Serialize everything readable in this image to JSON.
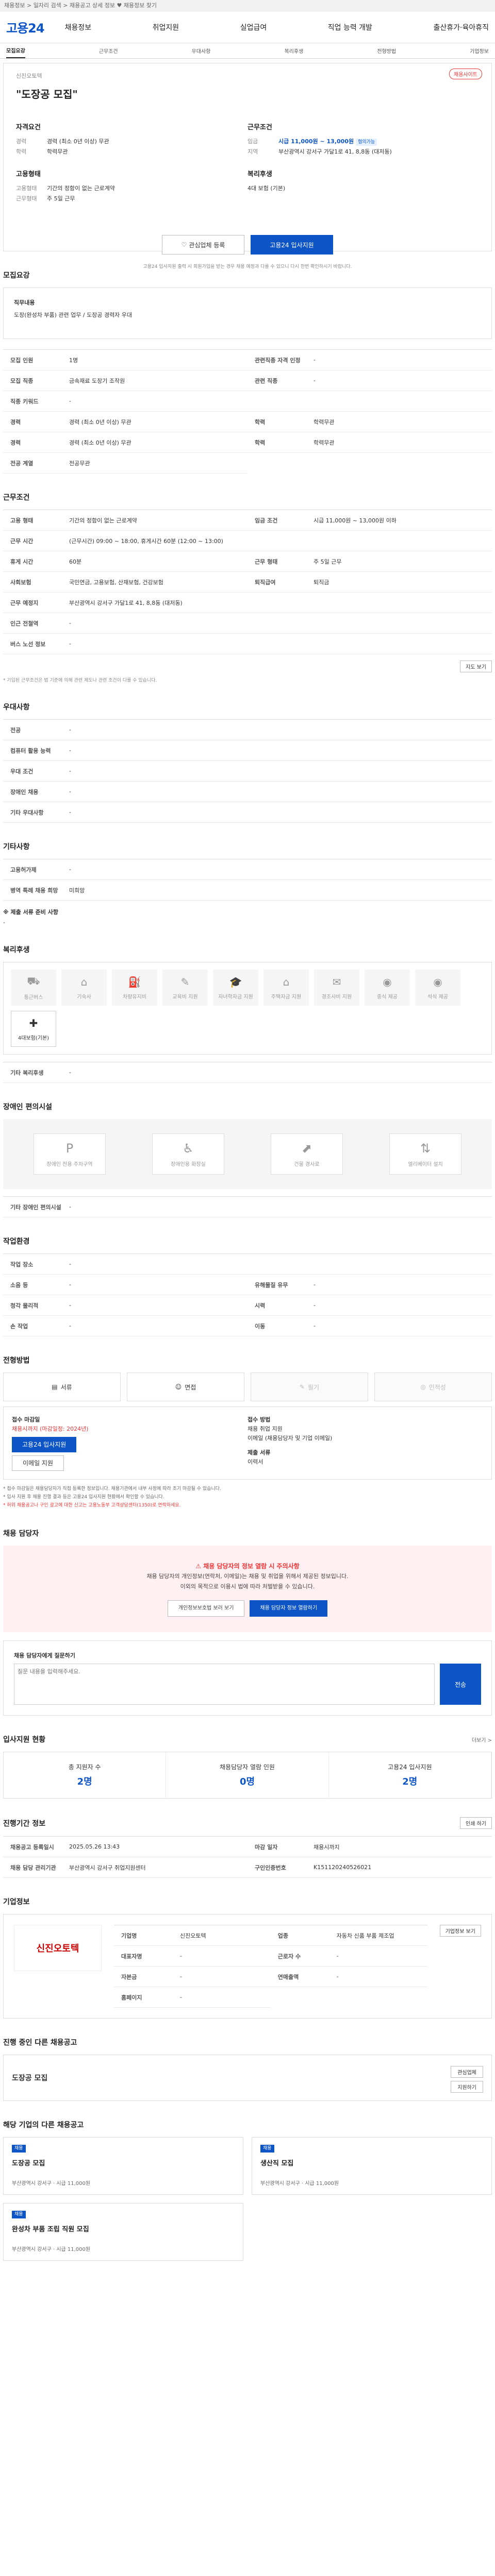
{
  "topbar": {
    "text": "채용정보 > 일자리 검색 > 채용공고 상세 정보 ♥ 채용정보 찾기"
  },
  "header": {
    "logo": "고용24",
    "menu": [
      "채용정보",
      "취업지원",
      "실업급여",
      "직업 능력 개발",
      "출산휴가·육아휴직"
    ]
  },
  "section_tabs": [
    "모집요강",
    "근무조건",
    "우대사항",
    "복리후생",
    "전형방법",
    "기업정보"
  ],
  "summary": {
    "company": "신진오토텍",
    "title": "\"도장공 모집\"",
    "badge": "채용사이트",
    "left_heading": "자격요건",
    "left": [
      {
        "k": "경력",
        "v": "경력 (최소 0년 이상) 무관"
      },
      {
        "k": "학력",
        "v": "학력무관"
      }
    ],
    "left2_heading": "고용형태",
    "left2": [
      {
        "k": "고용형태",
        "v": "기간의 정함이 없는 근로계약"
      },
      {
        "k": "근무형태",
        "v": "주 5일 근무"
      }
    ],
    "right_heading": "근무조건",
    "pay_label": "임금",
    "pay": "시급 11,000원 ~ 13,000원",
    "pay_tag": "협의가능",
    "loc_label": "지역",
    "loc": "부산광역시 강서구 가달1로 41, 8,8동 (대저동)",
    "right2_heading": "복리후생",
    "right2": "4대 보험 (기본)",
    "scrap_btn": "관심업체 등록",
    "apply_btn": "고용24 입사지원",
    "note": "고용24 입사지원 출력 시 회원가입을 받는 경우 채용 예정과 다를 수 있으니 다시 한번 확인하시기 바랍니다."
  },
  "recruit": {
    "heading": "모집요강",
    "duty_label": "직무내용",
    "duty": "도장(완성차 부품) 관련 업무 / 도장공 경력자 우대",
    "rows": [
      {
        "k": "모집 인원",
        "v": "1명"
      },
      {
        "k": "관련직종 자격 인정",
        "v": "-"
      },
      {
        "k": "모집 직종",
        "v": "금속재료 도장기 조작원"
      },
      {
        "k": "관련 직종",
        "v": "-"
      },
      {
        "k": "직종 키워드",
        "v": "-"
      },
      {
        "k": "",
        "v": ""
      },
      {
        "k": "경력",
        "v": "경력 (최소 0년 이상) 무관"
      },
      {
        "k": "학력",
        "v": "학력무관"
      },
      {
        "k": "경력",
        "v": "경력 (최소 0년 이상) 무관"
      },
      {
        "k": "학력",
        "v": "학력무관"
      },
      {
        "k": "전공 계열",
        "v": "전공무관"
      }
    ]
  },
  "work": {
    "heading": "근무조건",
    "rows": [
      {
        "k": "고용 형태",
        "v": "기간의 정함이 없는 근로계약"
      },
      {
        "k": "임금 조건",
        "v": "시급 11,000원 ~ 13,000원 이하"
      },
      {
        "k": "근무 시간",
        "v": "(근무시간) 09:00 ~ 18:00, 휴게시간 60분 (12:00 ~ 13:00)",
        "full": true
      },
      {
        "k": "휴게 시간",
        "v": "60분"
      },
      {
        "k": "근무 형태",
        "v": "주 5일 근무"
      },
      {
        "k": "사회보험",
        "v": "국민연금, 고용보험, 산재보험, 건강보험"
      },
      {
        "k": "퇴직급여",
        "v": "퇴직금"
      },
      {
        "k": "근무 예정지",
        "v": "부산광역시 강서구 가달1로 41, 8,8동 (대저동)",
        "full": true
      },
      {
        "k": "인근 전철역",
        "v": "-",
        "full": true
      },
      {
        "k": "버스 노선 정보",
        "v": "-",
        "full": true
      }
    ],
    "map_btn": "지도 보기",
    "note": "* 기입된 근무조건은 법 기준에 의해 관련 제도나 관련 조건이 다를 수 있습니다."
  },
  "pref": {
    "heading": "우대사항",
    "rows": [
      {
        "k": "전공",
        "v": "-"
      },
      {
        "k": "컴퓨터 활용 능력",
        "v": "-"
      },
      {
        "k": "우대 조건",
        "v": "-"
      },
      {
        "k": "장애인 채용",
        "v": "-"
      },
      {
        "k": "기타 우대사항",
        "v": "-"
      }
    ]
  },
  "etc": {
    "heading": "기타사항",
    "rows": [
      {
        "k": "고용허가제",
        "v": "-"
      },
      {
        "k": "병역 특례 채용 희망",
        "v": "미희망"
      }
    ],
    "docs_label": "※ 제출 서류 준비 사항",
    "docs": "-"
  },
  "welfare": {
    "heading": "복리후생",
    "items": [
      "통근버스",
      "기숙사",
      "차량유지비",
      "교육비 지원",
      "자녀학자금 지원",
      "주택자금 지원",
      "경조사비 지원",
      "중식 제공",
      "석식 제공",
      "4대보험(기본)"
    ],
    "etc_label": "기타 복리후생",
    "etc": "-"
  },
  "disability": {
    "heading": "장애인 편의시설",
    "items": [
      "장애인 전용 주차구역",
      "장애인용 화장실",
      "건물 경사로",
      "엘리베이터 설치"
    ],
    "etc_label": "기타 장애인 편의시설",
    "etc": "-"
  },
  "place": {
    "heading": "작업환경",
    "rows": [
      {
        "k": "작업 장소",
        "v": "-",
        "full": true
      },
      {
        "k": "소음 등",
        "v": "-"
      },
      {
        "k": "유해물질 유무",
        "v": "-"
      },
      {
        "k": "청각 물리적",
        "v": "-"
      },
      {
        "k": "시력",
        "v": "-"
      },
      {
        "k": "손 작업",
        "v": "-"
      },
      {
        "k": "이동",
        "v": "-"
      }
    ]
  },
  "method": {
    "heading": "전형방법",
    "apply_btns": [
      "서류",
      "면접",
      "필기",
      "인적성"
    ],
    "left_title": "접수 마감일",
    "left_deadline": "채용시까지 (마감일정: 2024년)",
    "left_btn1": "고용24 입사지원",
    "left_btn2": "이메일 지원",
    "right_title": "접수 방법",
    "right_lines": [
      "채용 취업 지원",
      "이메일 (채용담당자 및 기업 이메일)"
    ],
    "right2_title": "제출 서류",
    "right2": "이력서",
    "notes": [
      "* 접수 마감일은 채용담당자가 직접 등록한 정보입니다. 채용기관에서 내부 사정에 따라 조기 마감될 수 있습니다.",
      "* 입사 지원 후 채용 진행 결과 등은 고용24 입사지원 현황에서 확인할 수 있습니다.",
      "* 허위 채용공고나 구인 광고에 대한 신고는 고용노동부 고객상담센터(1350)로 연락하세요."
    ]
  },
  "contact": {
    "heading": "채용 담당자",
    "alert": "채용 담당자의 정보 열람 시 주의사항",
    "lines": [
      "채용 담당자의 개인정보(연락처, 이메일)는 채용 및 취업을 위해서 제공된 정보입니다.",
      "이외의 목적으로 이용시 법에 따라 처벌받을 수 있습니다."
    ],
    "btn1": "개인정보보호법 보러 보기",
    "btn2": "채용 담당자 정보 열람하기",
    "qa_title": "채용 담당자에게 질문하기",
    "qa_placeholder": "질문 내용을 입력해주세요.",
    "qa_btn": "전송"
  },
  "stats": {
    "heading": "입사지원 현황",
    "items": [
      {
        "k": "총 지원자 수",
        "v": "2명"
      },
      {
        "k": "채용담당자 열람 인원",
        "v": "0명"
      },
      {
        "k": "고용24 입사지원",
        "v": "2명"
      }
    ],
    "more": "더보기 >"
  },
  "notice": {
    "heading": "진행기간 정보",
    "rows": [
      {
        "k": "채용공고 등록일시",
        "v": "2025.05.26 13:43"
      },
      {
        "k": "마감 일자",
        "v": "채용시까지"
      },
      {
        "k": "채용 담당 관리기관",
        "v": "부산광역시 강서구 취업지원센터"
      },
      {
        "k": "구인인증번호",
        "v": "K151120240526021"
      }
    ],
    "btn": "인쇄 하기"
  },
  "company": {
    "heading": "기업정보",
    "logo_text": "신진오토텍",
    "name": "신진오토텍",
    "rows": [
      {
        "k": "기업명",
        "v": "신진오토텍"
      },
      {
        "k": "업종",
        "v": "자동차 신품 부품 제조업"
      },
      {
        "k": "대표자명",
        "v": "-"
      },
      {
        "k": "근로자 수",
        "v": "-"
      },
      {
        "k": "자본금",
        "v": "-"
      },
      {
        "k": "연매출액",
        "v": "-"
      },
      {
        "k": "홈페이지",
        "v": "-"
      }
    ],
    "btn": "기업정보 보기"
  },
  "other": {
    "heading": "진행 중인 다른 채용공고",
    "title": "도장공 모집",
    "btn1": "관심업체",
    "btn2": "지원하기"
  },
  "related": {
    "heading": "해당 기업의 다른 채용공고",
    "cards": [
      {
        "tag": "채용",
        "title": "도장공 모집",
        "meta": "부산광역시 강서구 · 시급 11,000원"
      },
      {
        "tag": "채용",
        "title": "생산직 모집",
        "meta": "부산광역시 강서구 · 시급 11,000원"
      },
      {
        "tag": "채용",
        "title": "완성차 부품 조립 직원 모집",
        "meta": "부산광역시 강서구 · 시급 11,000원"
      }
    ]
  }
}
